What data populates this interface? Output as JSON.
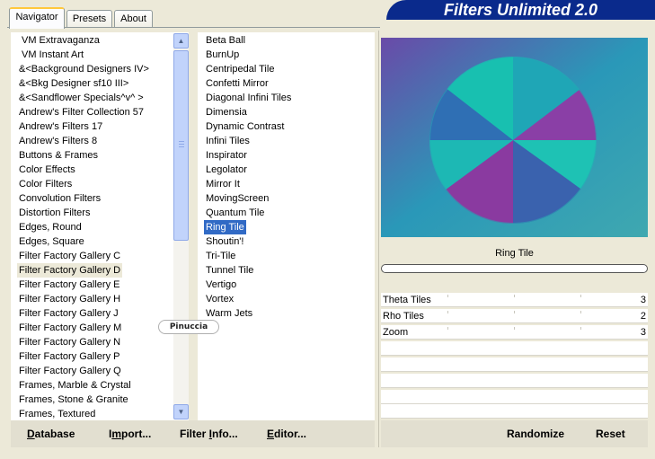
{
  "app": {
    "title": "Filters Unlimited 2.0"
  },
  "tabs": [
    {
      "label": "Navigator",
      "active": true
    },
    {
      "label": "Presets",
      "active": false
    },
    {
      "label": "About",
      "active": false
    }
  ],
  "categories": [
    "VM Extravaganza",
    "VM Instant Art",
    "&<Background Designers IV>",
    "&<Bkg Designer sf10 III>",
    "&<Sandflower Specials^v^ >",
    "Andrew's Filter Collection 57",
    "Andrew's Filters 17",
    "Andrew's Filters 8",
    "Buttons & Frames",
    "Color Effects",
    "Color Filters",
    "Convolution Filters",
    "Distortion Filters",
    "Edges, Round",
    "Edges, Square",
    "Filter Factory Gallery C",
    "Filter Factory Gallery D",
    "Filter Factory Gallery E",
    "Filter Factory Gallery H",
    "Filter Factory Gallery J",
    "Filter Factory Gallery M",
    "Filter Factory Gallery N",
    "Filter Factory Gallery P",
    "Filter Factory Gallery Q",
    "Frames, Marble & Crystal",
    "Frames, Stone & Granite",
    "Frames, Textured"
  ],
  "highlighted_category": "Filter Factory Gallery D",
  "filters": [
    "Beta Ball",
    "BurnUp",
    "Centripedal Tile",
    "Confetti Mirror",
    "Diagonal Infini Tiles",
    "Dimensia",
    "Dynamic Contrast",
    "Infini Tiles",
    "Inspirator",
    "Legolator",
    "Mirror It",
    "MovingScreen",
    "Quantum Tile",
    "Ring Tile",
    "Shoutin'!",
    "Tri-Tile",
    "Tunnel Tile",
    "Vertigo",
    "Vortex",
    "Warm Jets"
  ],
  "selected_filter": "Ring Tile",
  "watermark": "Pinuccia",
  "preview": {
    "current_filter_label": "Ring Tile",
    "colors": {
      "teal": "#1ec2b4",
      "purple": "#8a3aa0",
      "blue": "#3a6ab8"
    }
  },
  "sliders": [
    {
      "label": "Theta Tiles",
      "value": "3"
    },
    {
      "label": "Rho Tiles",
      "value": "2"
    },
    {
      "label": "Zoom",
      "value": "3"
    }
  ],
  "buttons": {
    "database": {
      "ul": "D",
      "rest": "atabase"
    },
    "import": {
      "pre": "I",
      "ul": "m",
      "rest": "port..."
    },
    "filter_info": {
      "pre": "Filter ",
      "ul": "I",
      "rest": "nfo..."
    },
    "editor": {
      "ul": "E",
      "rest": "ditor..."
    },
    "randomize": "Randomize",
    "reset": "Reset"
  },
  "scrollbar": {
    "up_icon": "arrow-up-icon",
    "down_icon": "arrow-down-icon"
  }
}
